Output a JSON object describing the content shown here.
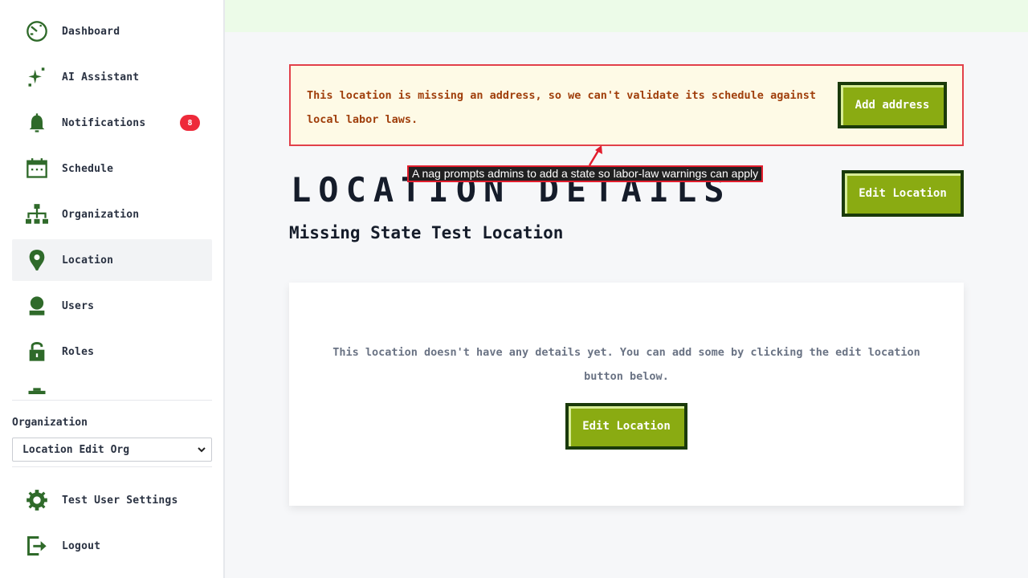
{
  "sidebar": {
    "items": [
      {
        "label": "Dashboard",
        "icon": "dashboard-icon"
      },
      {
        "label": "AI Assistant",
        "icon": "sparkle-icon"
      },
      {
        "label": "Notifications",
        "icon": "bell-icon",
        "badge": "8"
      },
      {
        "label": "Schedule",
        "icon": "calendar-icon"
      },
      {
        "label": "Organization",
        "icon": "org-chart-icon"
      },
      {
        "label": "Location",
        "icon": "map-pin-icon",
        "active": true
      },
      {
        "label": "Users",
        "icon": "user-icon"
      },
      {
        "label": "Roles",
        "icon": "lock-icon"
      }
    ],
    "org_label": "Organization",
    "org_selected": "Location Edit Org",
    "bottom_items": [
      {
        "label": "Test User Settings",
        "icon": "gear-icon"
      },
      {
        "label": "Logout",
        "icon": "logout-icon"
      }
    ]
  },
  "alert": {
    "message": "This location is missing an address, so we can't validate its schedule against local labor laws.",
    "button_label": "Add address"
  },
  "page": {
    "title": "LOCATION DETAILS",
    "subtitle": "Missing State Test Location",
    "edit_button_label": "Edit Location"
  },
  "card": {
    "empty_text": "This location doesn't have any details yet. You can add some by clicking the edit location button below.",
    "edit_button_label": "Edit Location"
  },
  "annotation": {
    "text": "A nag prompts admins to add a state so labor-law warnings can apply"
  },
  "colors": {
    "accent": "#8aab12",
    "accent_border": "#1a3a0a",
    "icon": "#2f6a2a",
    "alert_border": "#e2404a",
    "alert_bg": "#fefae6",
    "alert_text": "#a03f0c",
    "badge": "#ee2a3a"
  }
}
